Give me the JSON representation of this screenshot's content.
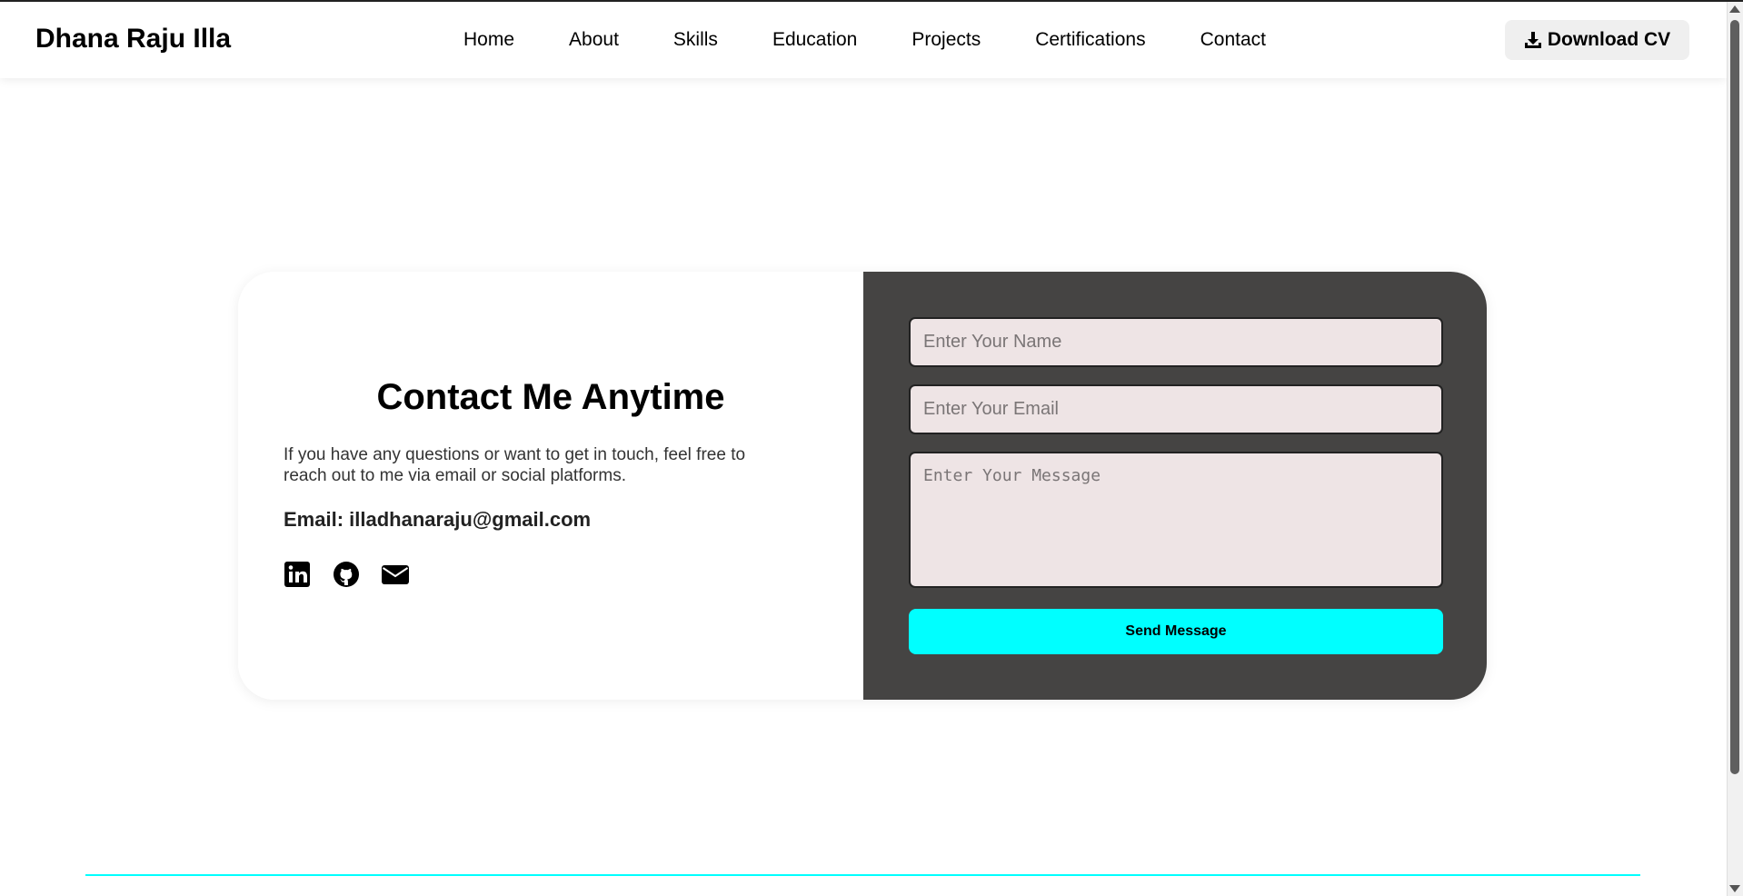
{
  "header": {
    "brand": "Dhana Raju Illa",
    "nav": [
      "Home",
      "About",
      "Skills",
      "Education",
      "Projects",
      "Certifications",
      "Contact"
    ],
    "download_cv_label": "Download CV",
    "download_icon": "download-icon"
  },
  "contact": {
    "title": "Contact Me Anytime",
    "description": "If you have any questions or want to get in touch, feel free to reach out to me via email or social platforms.",
    "email_line": "Email: illadhanaraju@gmail.com",
    "socials": [
      "linkedin-icon",
      "github-icon",
      "envelope-icon"
    ]
  },
  "form": {
    "name_placeholder": "Enter Your Name",
    "email_placeholder": "Enter Your Email",
    "message_placeholder": "Enter Your Message",
    "send_label": "Send Message"
  },
  "colors": {
    "accent": "#00ffff",
    "form_panel": "#454443",
    "field_bg": "#eee4e5"
  }
}
